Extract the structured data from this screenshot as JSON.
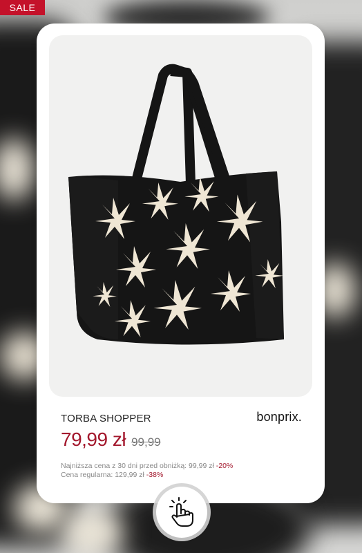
{
  "badge": {
    "sale": "SALE"
  },
  "product": {
    "title": "TORBA SHOPPER",
    "brand": "bonprix.",
    "price": "79,99 zł",
    "old_price": "99,99",
    "lowest_price_label": "Najniższa cena z 30 dni przed obniżką: 99,99 zł",
    "lowest_price_discount": "-20%",
    "regular_price_label": "Cena regularna: 129,99 zł",
    "regular_price_discount": "-38%"
  },
  "icons": {
    "tap": "tap-hand-icon"
  },
  "colors": {
    "accent": "#a3182d",
    "badge": "#c4122a",
    "bag": "#151515",
    "flower": "#efe6d4"
  }
}
